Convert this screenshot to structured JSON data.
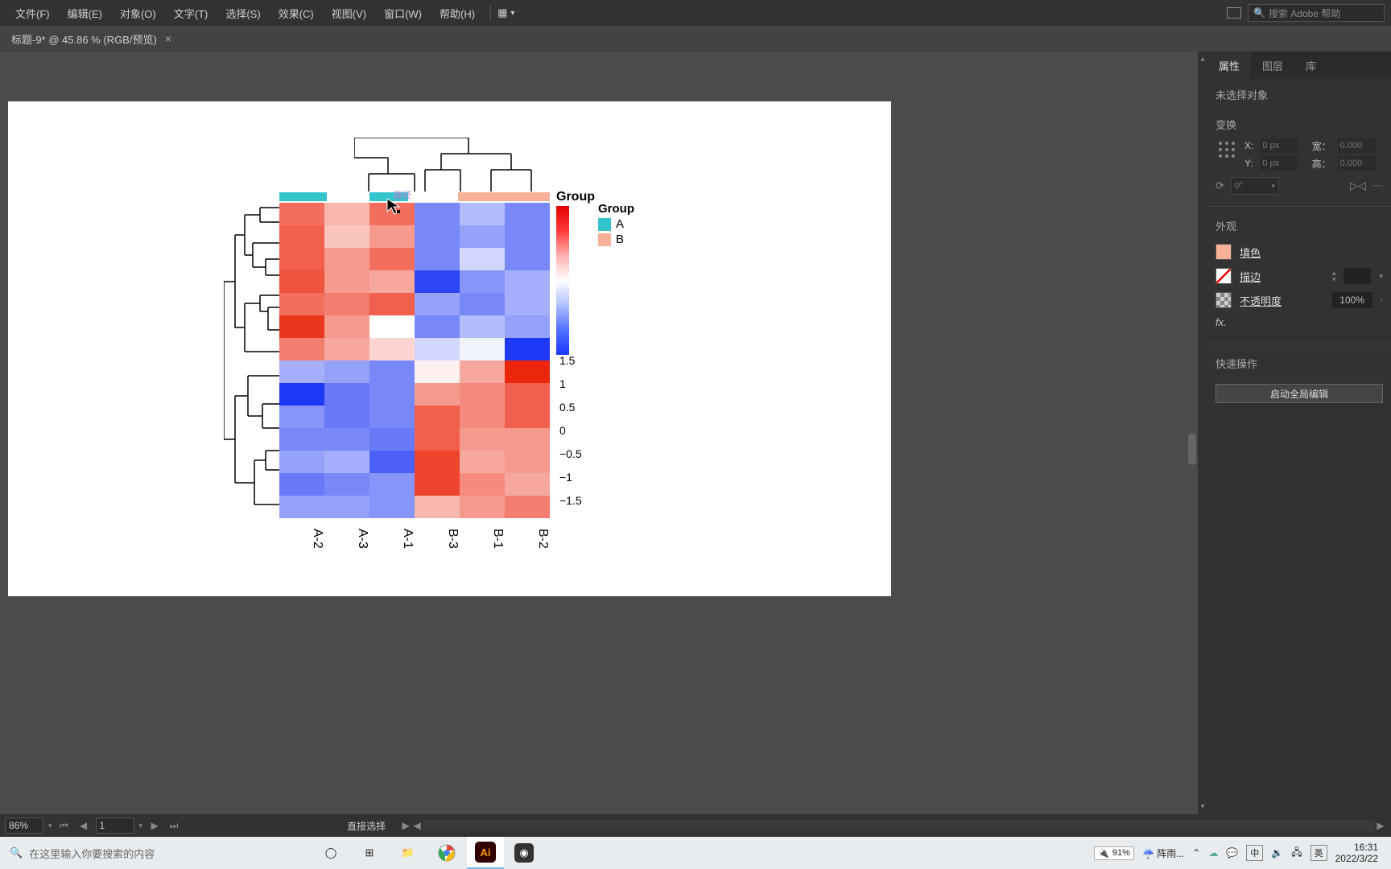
{
  "menu": [
    "文件(F)",
    "编辑(E)",
    "对象(O)",
    "文字(T)",
    "选择(S)",
    "效果(C)",
    "视图(V)",
    "窗口(W)",
    "帮助(H)"
  ],
  "search_placeholder": "搜索 Adobe 帮助",
  "tab_title": "标题-9* @ 45.86 % (RGB/预览)",
  "path_label": "路径",
  "panel": {
    "tabs": [
      "属性",
      "图层",
      "库"
    ],
    "no_selection": "未选择对象",
    "section_transform": "变换",
    "x_label": "X:",
    "y_label": "Y:",
    "w_label": "宽：",
    "h_label": "高：",
    "x_val": "0 px",
    "y_val": "0 px",
    "w_val": "0.000",
    "h_val": "0.000",
    "rotate_val": "0°",
    "section_appear": "外观",
    "fill_label": "填色",
    "stroke_label": "描边",
    "opacity_label": "不透明度",
    "opacity_val": "100%",
    "fx_label": "fx.",
    "section_quick": "快速操作",
    "quick_btn": "启动全局编辑"
  },
  "status": {
    "zoom": "86%",
    "artboard": "1",
    "tool": "直接选择"
  },
  "taskbar": {
    "search_placeholder": "在这里输入你要搜索的内容",
    "battery": "91%",
    "weather": "阵雨...",
    "ime1": "中",
    "ime2": "英",
    "time": "16:31",
    "date": "2022/3/22"
  },
  "chart_data": {
    "type": "heatmap",
    "title": "",
    "columns": [
      "A-2",
      "A-3",
      "A-1",
      "B-3",
      "B-1",
      "B-2"
    ],
    "column_groups": [
      "A",
      "A",
      "A",
      "B",
      "B",
      "B"
    ],
    "group_colors": {
      "A": "#33c4cc",
      "B": "#f7b199"
    },
    "legend_title": "Group",
    "colorbar_title": "Group",
    "colorbar_range": [
      -1.5,
      1.5
    ],
    "colorbar_ticks": [
      1.5,
      1,
      0.5,
      0,
      -0.5,
      -1,
      -1.5
    ],
    "values": [
      [
        1.0,
        0.5,
        1.0,
        -0.9,
        -0.5,
        -0.9
      ],
      [
        1.1,
        0.4,
        0.7,
        -0.9,
        -0.7,
        -0.9
      ],
      [
        1.1,
        0.7,
        1.0,
        -0.9,
        -0.3,
        -0.9
      ],
      [
        1.2,
        0.7,
        0.6,
        -1.4,
        -0.8,
        -0.6
      ],
      [
        1.0,
        0.9,
        1.1,
        -0.7,
        -0.9,
        -0.6
      ],
      [
        1.4,
        0.7,
        0.0,
        -0.9,
        -0.5,
        -0.7
      ],
      [
        0.9,
        0.6,
        0.3,
        -0.3,
        -0.1,
        -1.5
      ],
      [
        -0.6,
        -0.7,
        -0.9,
        0.1,
        0.6,
        1.5
      ],
      [
        -1.5,
        -1.0,
        -0.9,
        0.7,
        0.8,
        1.1
      ],
      [
        -0.8,
        -1.0,
        -0.9,
        1.1,
        0.8,
        1.1
      ],
      [
        -0.9,
        -0.9,
        -1.0,
        1.1,
        0.7,
        0.7
      ],
      [
        -0.7,
        -0.6,
        -1.2,
        1.3,
        0.6,
        0.7
      ],
      [
        -1.0,
        -0.9,
        -0.8,
        1.3,
        0.8,
        0.6
      ],
      [
        -0.7,
        -0.7,
        -0.8,
        0.5,
        0.7,
        0.9
      ]
    ]
  }
}
